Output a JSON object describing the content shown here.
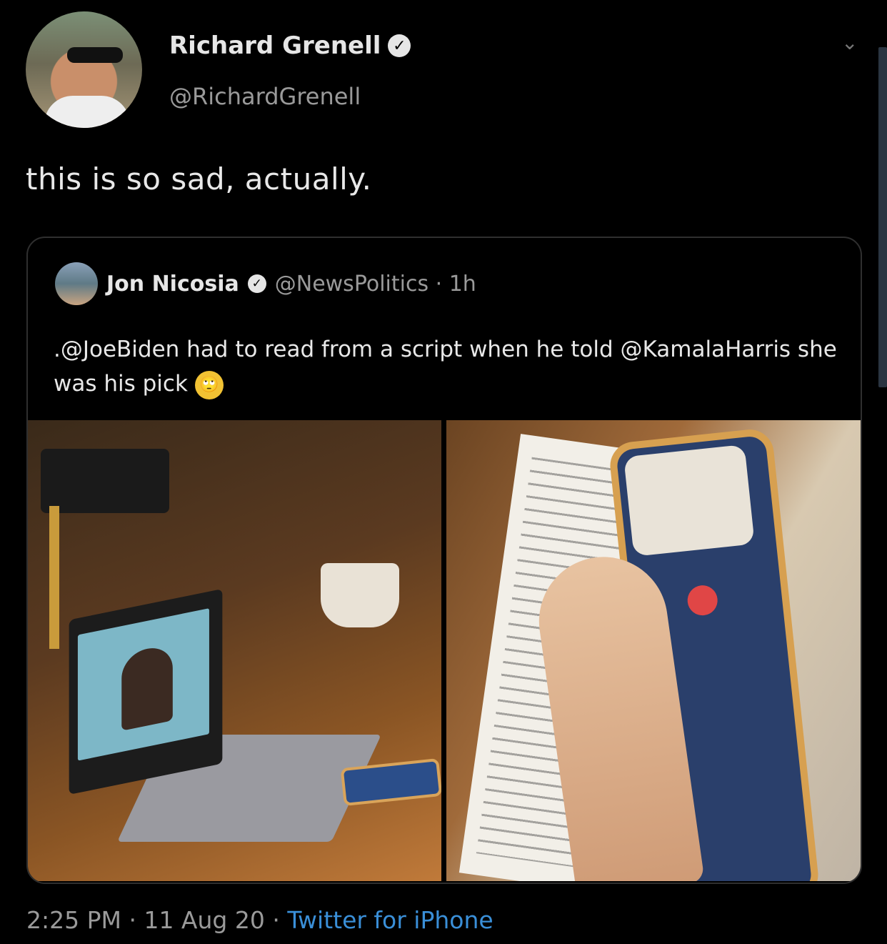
{
  "author": {
    "name": "Richard Grenell",
    "handle": "@RichardGrenell",
    "verified_glyph": "✓"
  },
  "icons": {
    "more_chevron": "⌄"
  },
  "tweet": {
    "text": "this is so sad, actually."
  },
  "quoted": {
    "name": "Jon Nicosia",
    "verified_glyph": "✓",
    "handle": "@NewsPolitics",
    "separator": " · ",
    "time": "1h",
    "text": ".@JoeBiden had to read from a script when he told @KamalaHarris she was his pick",
    "emoji": "🙄"
  },
  "meta": {
    "time": "2:25 PM",
    "sep1": " · ",
    "date": "11 Aug 20",
    "sep2": " · ",
    "source": "Twitter for iPhone"
  },
  "colors": {
    "background": "#000000",
    "link": "#3a8fd8",
    "muted": "#9a9a9a"
  }
}
